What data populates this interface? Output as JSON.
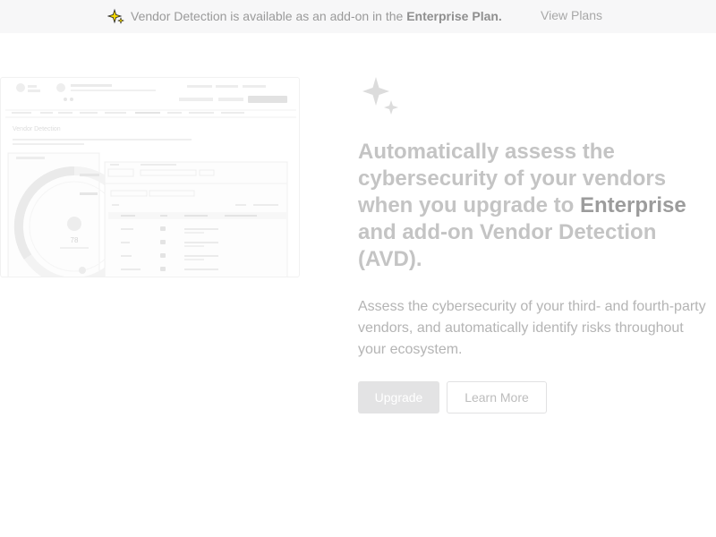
{
  "banner": {
    "icon": "sparkle-icon",
    "text_before": "Vendor Detection is available as an add-on in the",
    "plan_name": "Enterprise Plan.",
    "link_label": "View Plans"
  },
  "preview": {
    "page_title": "Vendor Detection",
    "score": "78"
  },
  "hero": {
    "icon": "sparkles-icon",
    "headline_part1": "Automatically assess the cybersecurity of your vendors when you upgrade to",
    "headline_emph": "Enterprise",
    "headline_part2": "and add-on Vendor Detection (AVD).",
    "description": "Assess the cybersecurity of your third- and fourth-party vendors, and automatically identify risks throughout your ecosystem.",
    "upgrade_label": "Upgrade",
    "learn_more_label": "Learn More"
  },
  "colors": {
    "banner_bg": "#f7f7f8",
    "primary_button_bg": "#e3e3e4",
    "icon_yellow": "#f5d800"
  }
}
